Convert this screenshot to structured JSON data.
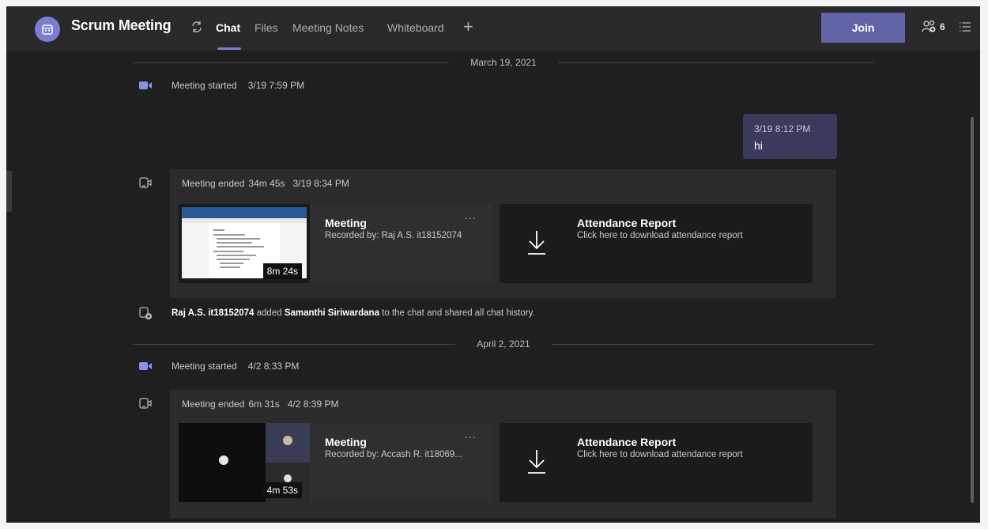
{
  "header": {
    "title": "Scrum Meeting",
    "tabs": [
      {
        "label": "Chat",
        "active": true
      },
      {
        "label": "Files",
        "active": false
      },
      {
        "label": "Meeting Notes",
        "active": false
      },
      {
        "label": "Whiteboard",
        "active": false
      }
    ],
    "add_tab": "+",
    "join_label": "Join",
    "participants_count": "6",
    "accent_color": "#6264a7"
  },
  "conversation": {
    "dividers": [
      "March 19, 2021",
      "April 2, 2021"
    ],
    "events": [
      {
        "text": "Meeting started",
        "time": "3/19 7:59 PM"
      },
      {
        "text": "Meeting started",
        "time": "4/2 8:33 PM"
      }
    ],
    "my_message": {
      "time": "3/19 8:12 PM",
      "text": "hi"
    },
    "cards": [
      {
        "ended_text": "Meeting ended",
        "duration": "34m 45s",
        "time": "3/19 8:34 PM",
        "recording": {
          "title": "Meeting",
          "recorded_by": "Recorded by: Raj A.S. it18152074",
          "length": "8m 24s",
          "more": "..."
        },
        "attendance": {
          "title": "Attendance Report",
          "subtitle": "Click here to download attendance report"
        }
      },
      {
        "ended_text": "Meeting ended",
        "duration": "6m 31s",
        "time": "4/2 8:39 PM",
        "recording": {
          "title": "Meeting",
          "recorded_by": "Recorded by: Accash R. it18069...",
          "length": "4m 53s",
          "more": "..."
        },
        "attendance": {
          "title": "Attendance Report",
          "subtitle": "Click here to download attendance report"
        }
      }
    ],
    "added": {
      "actor": "Raj A.S. it18152074",
      "verb": "added",
      "member": "Samanthi Siriwardana",
      "rest": "to the chat and shared all chat history."
    }
  },
  "icons": {
    "app": "calendar-icon",
    "sync": "sync-icon",
    "participants": "people-icon",
    "list": "list-icon",
    "meeting": "video-camera-icon",
    "ended": "call-ended-icon",
    "add_member": "add-member-icon",
    "download": "download-icon"
  }
}
